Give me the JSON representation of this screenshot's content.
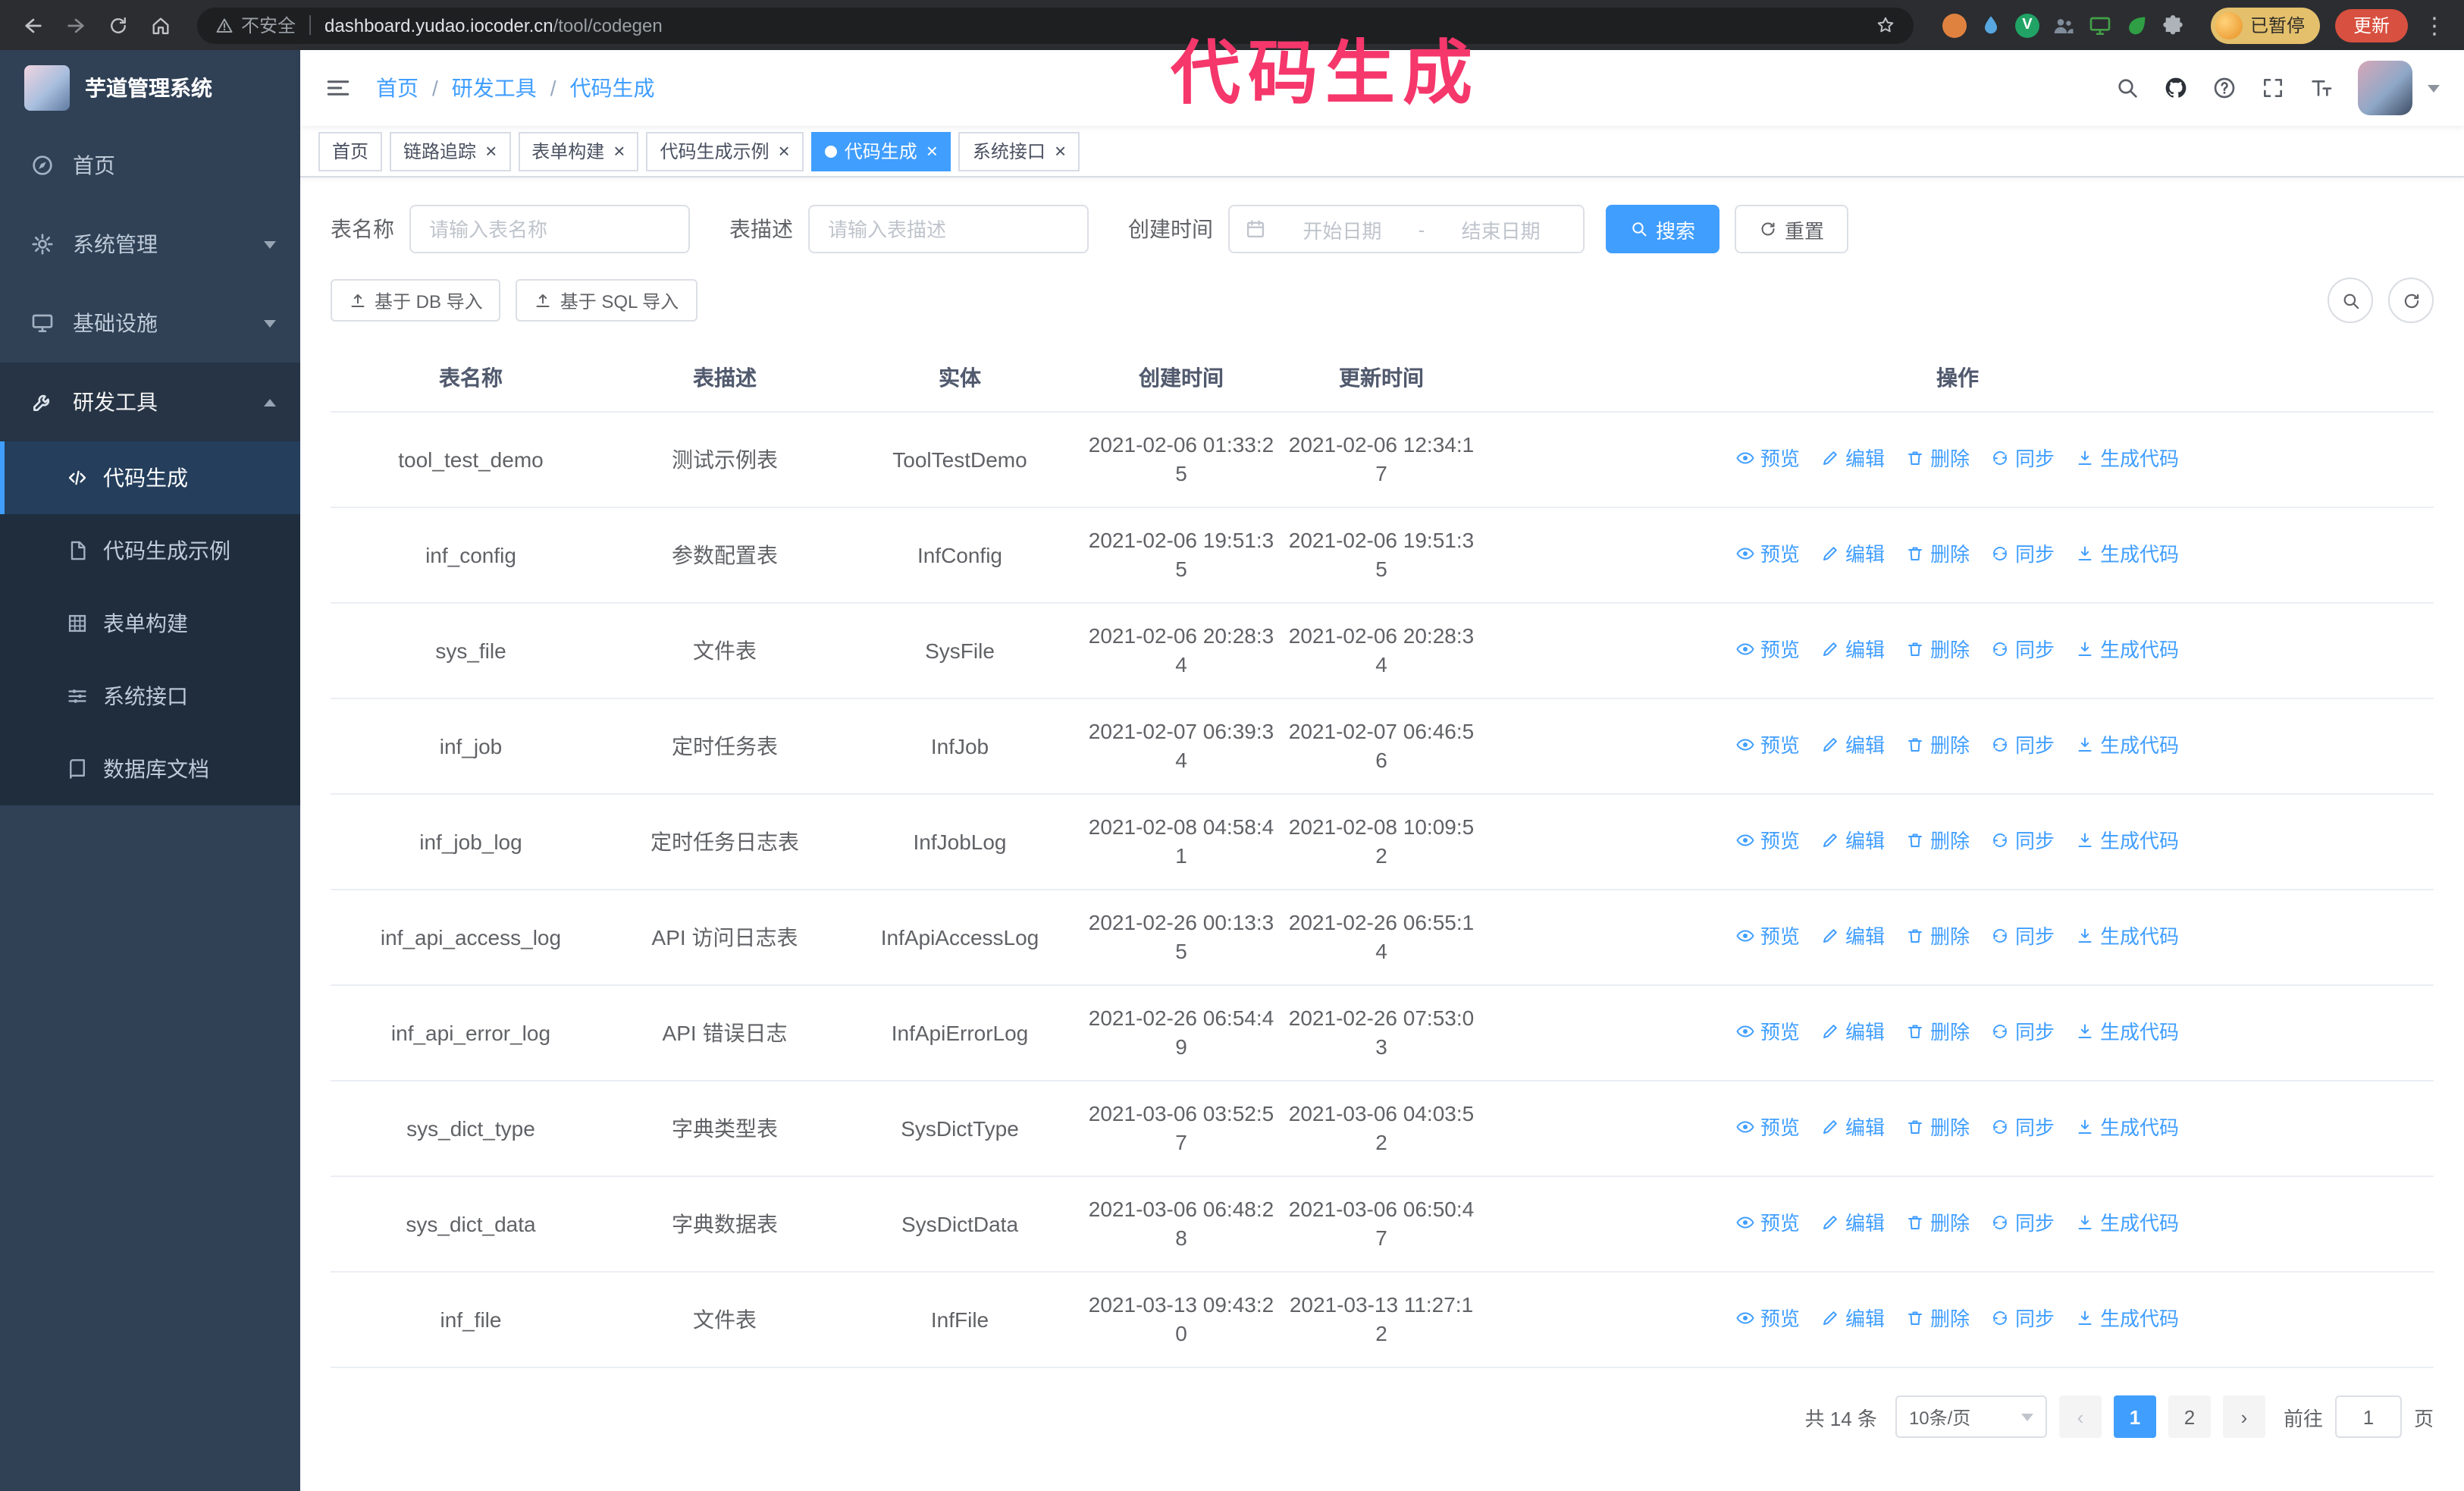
{
  "browser": {
    "security_warning": "不安全",
    "url_host": "dashboard.yudao.iocoder.cn",
    "url_path": "/tool/codegen",
    "paused_badge": "已暂停",
    "update_button": "更新",
    "extensions": [
      {
        "name": "extension-fox-icon",
        "type": "circle",
        "color": "#e0823f"
      },
      {
        "name": "extension-drop-icon",
        "type": "symbol",
        "symbol": "i-drop",
        "color": "#57a7e0"
      },
      {
        "name": "extension-v-icon",
        "type": "circle",
        "color": "#21a366",
        "glyph": "V"
      },
      {
        "name": "extension-people-icon",
        "type": "symbol",
        "symbol": "i-people",
        "color": "#7f8c9a"
      },
      {
        "name": "extension-screen-icon",
        "type": "symbol",
        "symbol": "i-monitor",
        "color": "#43a047"
      },
      {
        "name": "extension-leaf-icon",
        "type": "symbol",
        "symbol": "i-leaf",
        "color": "#2f9e44"
      },
      {
        "name": "extension-puzzle-icon",
        "type": "symbol",
        "symbol": "i-puzzle",
        "color": "#aeb3b9"
      }
    ]
  },
  "annotation": {
    "text": "代码生成",
    "color": "#f5376b"
  },
  "sidebar": {
    "app_title": "芋道管理系统",
    "menu": [
      {
        "id": "home",
        "label": "首页",
        "icon": "i-home"
      },
      {
        "id": "system",
        "label": "系统管理",
        "icon": "i-gear",
        "expandable": true
      },
      {
        "id": "infra",
        "label": "基础设施",
        "icon": "i-monitor",
        "expandable": true
      },
      {
        "id": "devtools",
        "label": "研发工具",
        "icon": "i-tools",
        "expandable": true,
        "expanded": true,
        "active": true,
        "children": [
          {
            "id": "codegen",
            "label": "代码生成",
            "icon": "i-code",
            "active": true
          },
          {
            "id": "codegen-example",
            "label": "代码生成示例",
            "icon": "i-doc"
          },
          {
            "id": "form-builder",
            "label": "表单构建",
            "icon": "i-grid"
          },
          {
            "id": "api",
            "label": "系统接口",
            "icon": "i-sliders"
          },
          {
            "id": "db-doc",
            "label": "数据库文档",
            "icon": "i-book"
          }
        ]
      }
    ]
  },
  "breadcrumb": [
    "首页",
    "研发工具",
    "代码生成"
  ],
  "tabs": [
    {
      "id": "home",
      "label": "首页",
      "closable": false
    },
    {
      "id": "tracer",
      "label": "链路追踪",
      "closable": true
    },
    {
      "id": "form-builder",
      "label": "表单构建",
      "closable": true
    },
    {
      "id": "codegen-example",
      "label": "代码生成示例",
      "closable": true
    },
    {
      "id": "codegen",
      "label": "代码生成",
      "closable": true,
      "active": true
    },
    {
      "id": "api",
      "label": "系统接口",
      "closable": true
    }
  ],
  "filters": {
    "table_name_label": "表名称",
    "table_name_placeholder": "请输入表名称",
    "table_desc_label": "表描述",
    "table_desc_placeholder": "请输入表描述",
    "create_time_label": "创建时间",
    "date_start_placeholder": "开始日期",
    "date_separator": "-",
    "date_end_placeholder": "结束日期",
    "search_button": "搜索",
    "reset_button": "重置"
  },
  "toolbar": {
    "import_db": "基于 DB 导入",
    "import_sql": "基于 SQL 导入"
  },
  "table": {
    "columns": [
      "表名称",
      "表描述",
      "实体",
      "创建时间",
      "更新时间",
      "操作"
    ],
    "actions": [
      {
        "id": "preview",
        "label": "预览",
        "icon": "i-eye"
      },
      {
        "id": "edit",
        "label": "编辑",
        "icon": "i-edit"
      },
      {
        "id": "delete",
        "label": "删除",
        "icon": "i-trash"
      },
      {
        "id": "sync",
        "label": "同步",
        "icon": "i-sync"
      },
      {
        "id": "generate",
        "label": "生成代码",
        "icon": "i-download"
      }
    ],
    "rows": [
      {
        "name": "tool_test_demo",
        "desc": "测试示例表",
        "entity": "ToolTestDemo",
        "created": "2021-02-06 01:33:25",
        "updated": "2021-02-06 12:34:17"
      },
      {
        "name": "inf_config",
        "desc": "参数配置表",
        "entity": "InfConfig",
        "created": "2021-02-06 19:51:35",
        "updated": "2021-02-06 19:51:35"
      },
      {
        "name": "sys_file",
        "desc": "文件表",
        "entity": "SysFile",
        "created": "2021-02-06 20:28:34",
        "updated": "2021-02-06 20:28:34"
      },
      {
        "name": "inf_job",
        "desc": "定时任务表",
        "entity": "InfJob",
        "created": "2021-02-07 06:39:34",
        "updated": "2021-02-07 06:46:56"
      },
      {
        "name": "inf_job_log",
        "desc": "定时任务日志表",
        "entity": "InfJobLog",
        "created": "2021-02-08 04:58:41",
        "updated": "2021-02-08 10:09:52"
      },
      {
        "name": "inf_api_access_log",
        "desc": "API 访问日志表",
        "entity": "InfApiAccessLog",
        "created": "2021-02-26 00:13:35",
        "updated": "2021-02-26 06:55:14"
      },
      {
        "name": "inf_api_error_log",
        "desc": "API 错误日志",
        "entity": "InfApiErrorLog",
        "created": "2021-02-26 06:54:49",
        "updated": "2021-02-26 07:53:03"
      },
      {
        "name": "sys_dict_type",
        "desc": "字典类型表",
        "entity": "SysDictType",
        "created": "2021-03-06 03:52:57",
        "updated": "2021-03-06 04:03:52"
      },
      {
        "name": "sys_dict_data",
        "desc": "字典数据表",
        "entity": "SysDictData",
        "created": "2021-03-06 06:48:28",
        "updated": "2021-03-06 06:50:47"
      },
      {
        "name": "inf_file",
        "desc": "文件表",
        "entity": "InfFile",
        "created": "2021-03-13 09:43:20",
        "updated": "2021-03-13 11:27:12"
      }
    ]
  },
  "pagination": {
    "total": "共 14 条",
    "page_size": "10条/页",
    "pages": [
      "1",
      "2"
    ],
    "active_page": "1",
    "goto_label": "前往",
    "goto_value": "1",
    "goto_suffix": "页"
  },
  "colors": {
    "accent": "#409eff",
    "sidebar_bg": "#304156",
    "submenu_bg": "#1f2d3d",
    "active_tab_bg": "#409eff",
    "annotation": "#f5376b"
  }
}
